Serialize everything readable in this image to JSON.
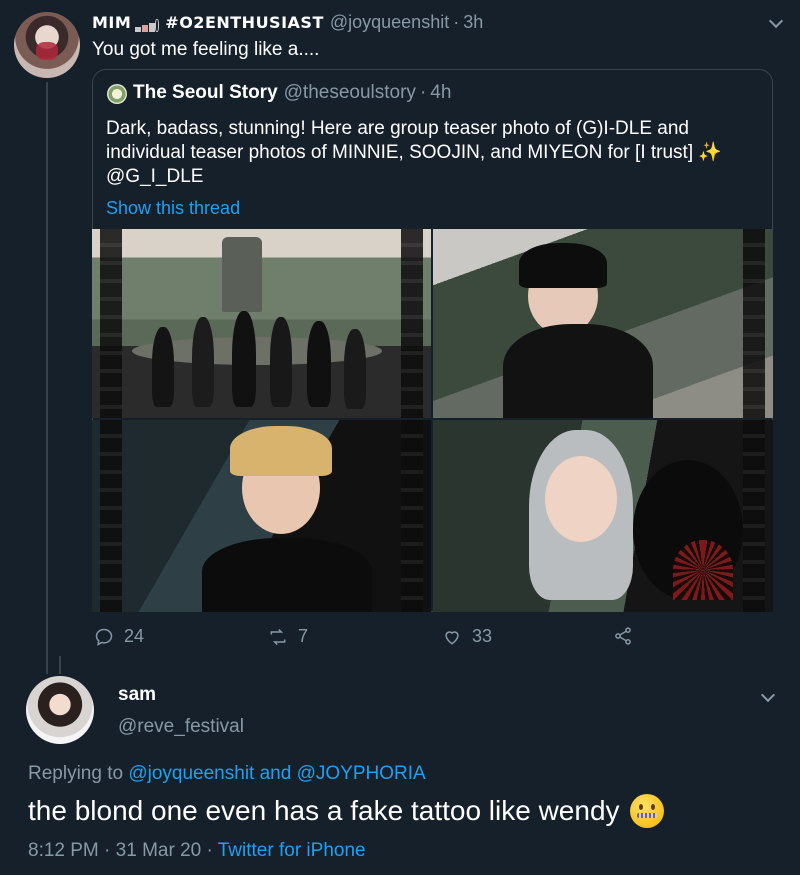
{
  "tweet": {
    "display_name": "MIM",
    "display_name_suffix": "#O2ENTHUSIAST",
    "handle": "@joyqueenshit",
    "time": "3h",
    "text": "You got me feeling like a...."
  },
  "quote": {
    "name": "The Seoul Story",
    "handle": "@theseoulstory",
    "time": "4h",
    "text_line1": "Dark, badass, stunning! Here are group teaser photo of (G)I-DLE and",
    "text_line2": "individual teaser photos of MINNIE, SOOJIN, and MIYEON for [I trust]",
    "sparkles": "✨",
    "text_line3": "@G_I_DLE",
    "show_thread": "Show this thread"
  },
  "actions": {
    "replies": "24",
    "retweets": "7",
    "likes": "33"
  },
  "reply": {
    "name": "sam",
    "handle": "@reve_festival",
    "replying_to_label": "Replying to",
    "replying_user_1": "@joyqueenshit",
    "and_label": "and",
    "replying_user_2": "@JOYPHORIA",
    "text": "the blond one even has a fake tattoo like wendy",
    "emoji": "zipper-mouth-face",
    "time": "8:12 PM",
    "date": "31 Mar 20",
    "source": "Twitter for iPhone"
  },
  "colors": {
    "background": "#15202b",
    "secondary_text": "#8899a6",
    "link": "#1da1f2",
    "border": "#38444d"
  }
}
